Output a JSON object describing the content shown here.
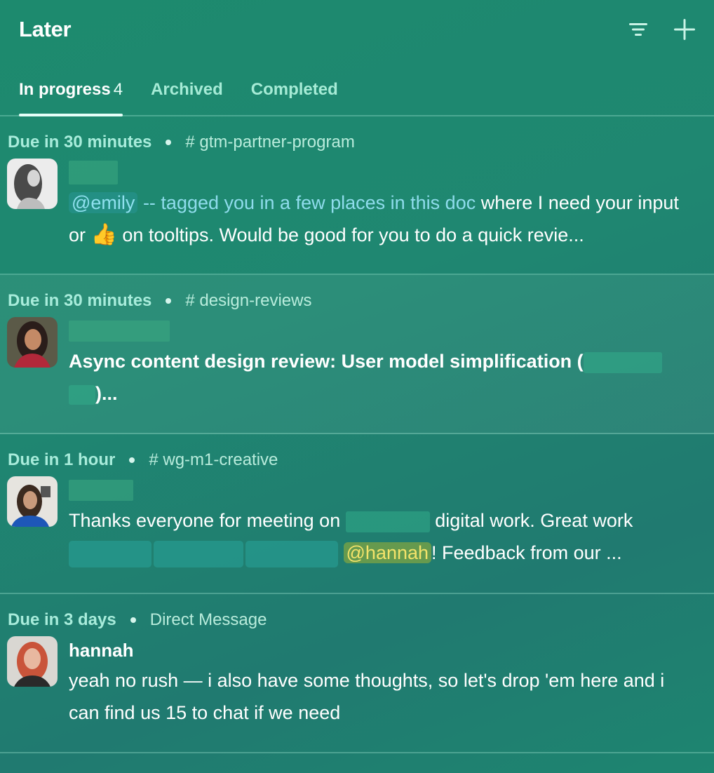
{
  "header": {
    "title": "Later",
    "filter_icon": "filter-icon",
    "add_icon": "plus-icon"
  },
  "tabs": [
    {
      "label": "In progress",
      "count": "4",
      "active": true
    },
    {
      "label": "Archived",
      "active": false
    },
    {
      "label": "Completed",
      "active": false
    }
  ],
  "items": [
    {
      "due": "Due in 30 minutes",
      "channel": "# gtm-partner-program",
      "sender": "",
      "message": {
        "mention": "@emily",
        "link_text": "-- tagged you in a few places in this doc",
        "text_after_link": " where I need your input or ",
        "emoji": "👍",
        "text_end": " on tooltips. Would be good for you to do a quick revie..."
      }
    },
    {
      "due": "Due in 30 minutes",
      "channel": "# design-reviews",
      "sender": "",
      "message": {
        "text_start": "Async content design review: User model simplification (",
        "text_end": ")..."
      }
    },
    {
      "due": "Due in 1 hour",
      "channel": "# wg-m1-creative",
      "sender": "",
      "message": {
        "text_start": "Thanks everyone for meeting on ",
        "text_mid": "digital work. Great work",
        "mention": "@hannah",
        "text_end": "! Feedback from our ..."
      }
    },
    {
      "due": "Due in 3 days",
      "channel": "Direct Message",
      "sender": "hannah",
      "message": {
        "text": "yeah no rush — i also have some thoughts, so let's drop 'em here and i can find us 15 to chat if we need"
      }
    }
  ],
  "colors": {
    "background": "#1f8771",
    "due_text": "#a8ecdb",
    "mention_yellow": "#f4e36a",
    "mention_blue": "#8fe0ee"
  }
}
